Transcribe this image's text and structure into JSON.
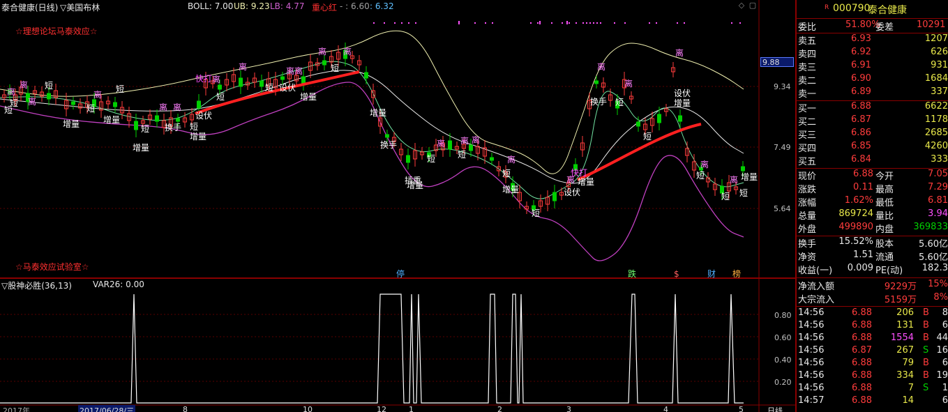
{
  "header": {
    "title": "泰合健康(日线)",
    "sector": "▽美国布林",
    "boll_label": "BOLL: 7.00",
    "ub_label": "UB: 9.23",
    "lb_label": "LB: 4.77",
    "zxh_label": "重心红",
    "zxh_v1": "- : 6.60",
    "zxh_v2": ": 6.32"
  },
  "forum": {
    "top_text": "☆理想论坛马泰效应☆",
    "bottom_text": "☆马泰效应试验室☆"
  },
  "price_axis": {
    "ticks": [
      "9.34",
      "7.49",
      "5.64"
    ],
    "current_tag": "9.88"
  },
  "signal_labels": [
    {
      "text": "离"
    },
    {
      "text": "离"
    },
    {
      "text": "短"
    },
    {
      "text": "短"
    },
    {
      "text": "离"
    },
    {
      "text": "短"
    },
    {
      "text": "离"
    },
    {
      "text": "短"
    },
    {
      "text": "增量"
    },
    {
      "text": "增量"
    },
    {
      "text": "短"
    },
    {
      "text": "增量"
    },
    {
      "text": "离"
    },
    {
      "text": "离"
    },
    {
      "text": "换手"
    },
    {
      "text": "短"
    },
    {
      "text": "设伏"
    },
    {
      "text": "增量"
    },
    {
      "text": "快打"
    },
    {
      "text": "离"
    },
    {
      "text": "短"
    },
    {
      "text": "离"
    },
    {
      "text": "短"
    },
    {
      "text": "设伏"
    },
    {
      "text": "离离"
    },
    {
      "text": "短"
    },
    {
      "text": "增量"
    },
    {
      "text": "离"
    },
    {
      "text": "离"
    },
    {
      "text": "短"
    },
    {
      "text": "增量"
    },
    {
      "text": "换手"
    },
    {
      "text": "离"
    },
    {
      "text": "短"
    },
    {
      "text": "离"
    },
    {
      "text": "短"
    },
    {
      "text": "离"
    },
    {
      "text": "插重"
    },
    {
      "text": "增量"
    },
    {
      "text": "短"
    },
    {
      "text": "离"
    },
    {
      "text": "增量"
    },
    {
      "text": "短"
    },
    {
      "text": "离"
    },
    {
      "text": "增量"
    },
    {
      "text": "设伏"
    },
    {
      "text": "快打"
    },
    {
      "text": "离"
    },
    {
      "text": "换手"
    },
    {
      "text": "短"
    },
    {
      "text": "离"
    },
    {
      "text": "短"
    },
    {
      "text": "设伏"
    },
    {
      "text": "增量"
    },
    {
      "text": "离"
    },
    {
      "text": "离"
    },
    {
      "text": "短"
    },
    {
      "text": "离"
    },
    {
      "text": "短"
    },
    {
      "text": "短"
    },
    {
      "text": "增量"
    }
  ],
  "event_markers": [
    {
      "text": "停",
      "color": "#4fb0ff"
    },
    {
      "text": "跌",
      "color": "#70ff70"
    },
    {
      "text": "$",
      "color": "#ff6060"
    },
    {
      "text": "财",
      "color": "#4fb0ff"
    },
    {
      "text": "榜",
      "color": "#ffb040"
    }
  ],
  "sub_indicator": {
    "title": "▽股神必胜(36,13)",
    "var_label": "VAR26: 0.00",
    "ticks": [
      "0.80",
      "0.60",
      "0.40",
      "0.20"
    ]
  },
  "date_axis": {
    "year": "2017年",
    "cursor_date": "2017/06/28/三",
    "months": [
      "8",
      "10",
      "12",
      "1",
      "2",
      "3",
      "4",
      "5"
    ],
    "period": "日线"
  },
  "quote": {
    "flag": "R",
    "code": "000790",
    "name": "泰合健康",
    "weibi_label": "委比",
    "weibi_value": "51.80%",
    "weicha_label": "委差",
    "weicha_value": "10291",
    "asks": [
      {
        "label": "卖五",
        "price": "6.93",
        "vol": "1207"
      },
      {
        "label": "卖四",
        "price": "6.92",
        "vol": "626"
      },
      {
        "label": "卖三",
        "price": "6.91",
        "vol": "931"
      },
      {
        "label": "卖二",
        "price": "6.90",
        "vol": "1684"
      },
      {
        "label": "卖一",
        "price": "6.89",
        "vol": "337"
      }
    ],
    "bids": [
      {
        "label": "买一",
        "price": "6.88",
        "vol": "6622"
      },
      {
        "label": "买二",
        "price": "6.87",
        "vol": "1178"
      },
      {
        "label": "买三",
        "price": "6.86",
        "vol": "2685"
      },
      {
        "label": "买四",
        "price": "6.85",
        "vol": "4260"
      },
      {
        "label": "买五",
        "price": "6.84",
        "vol": "333"
      }
    ],
    "stats": [
      {
        "l1": "现价",
        "v1": "6.88",
        "c1": "red",
        "l2": "今开",
        "v2": "7.05",
        "c2": "red"
      },
      {
        "l1": "涨跌",
        "v1": "0.11",
        "c1": "red",
        "l2": "最高",
        "v2": "7.29",
        "c2": "red"
      },
      {
        "l1": "涨幅",
        "v1": "1.62%",
        "c1": "red",
        "l2": "最低",
        "v2": "6.81",
        "c2": "red"
      },
      {
        "l1": "总量",
        "v1": "869724",
        "c1": "yellow",
        "l2": "量比",
        "v2": "3.94",
        "c2": "mag"
      },
      {
        "l1": "外盘",
        "v1": "499890",
        "c1": "red",
        "l2": "内盘",
        "v2": "369833",
        "c2": "green"
      }
    ],
    "stats2": [
      {
        "l1": "换手",
        "v1": "15.52%",
        "l2": "股本",
        "v2": "5.60亿"
      },
      {
        "l1": "净资",
        "v1": "1.51",
        "l2": "流通",
        "v2": "5.60亿"
      },
      {
        "l1": "收益(一)",
        "v1": "0.009",
        "l2": "PE(动)",
        "v2": "182.3"
      }
    ],
    "flows": [
      {
        "label": "净流入额",
        "value": "9229万",
        "pct": "15%"
      },
      {
        "label": "大宗流入",
        "value": "5159万",
        "pct": "8%"
      }
    ],
    "ticks": [
      {
        "time": "14:56",
        "price": "6.88",
        "vol": "206",
        "vcolor": "yellow",
        "side": "B",
        "extra": "8"
      },
      {
        "time": "14:56",
        "price": "6.88",
        "vol": "131",
        "vcolor": "yellow",
        "side": "B",
        "extra": "6"
      },
      {
        "time": "14:56",
        "price": "6.88",
        "vol": "1554",
        "vcolor": "mag",
        "side": "B",
        "extra": "44"
      },
      {
        "time": "14:56",
        "price": "6.87",
        "vol": "267",
        "vcolor": "yellow",
        "side": "S",
        "extra": "16"
      },
      {
        "time": "14:56",
        "price": "6.88",
        "vol": "79",
        "vcolor": "yellow",
        "side": "B",
        "extra": "6"
      },
      {
        "time": "14:56",
        "price": "6.88",
        "vol": "334",
        "vcolor": "yellow",
        "side": "B",
        "extra": "19"
      },
      {
        "time": "14:56",
        "price": "6.88",
        "vol": "7",
        "vcolor": "yellow",
        "side": "S",
        "extra": "1"
      },
      {
        "time": "14:57",
        "price": "6.88",
        "vol": "14",
        "vcolor": "yellow",
        "side": "",
        "extra": "6"
      }
    ]
  },
  "colors": {
    "up": "#ff3c3c",
    "down": "#00d000",
    "panel_border": "#8a0000",
    "boll_mid": "#e8e8e8",
    "boll_upper": "#f0f0b0",
    "boll_lower": "#c040c0",
    "zxh_line": "#ff2020"
  }
}
